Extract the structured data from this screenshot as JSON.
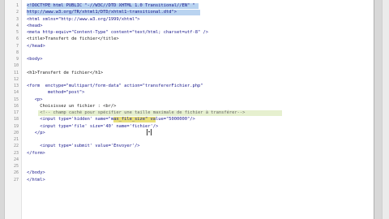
{
  "editor": {
    "line_numbers": [
      "1",
      "2",
      "3",
      "4",
      "5",
      "6",
      "7",
      "8",
      "9",
      "10",
      "11",
      "12",
      "13",
      "14",
      "15",
      "16",
      "17",
      "18",
      "19",
      "20",
      "21",
      "22",
      "23",
      "24",
      "25",
      "26",
      "27"
    ],
    "lines": [
      "<!DOCTYPE html PUBLIC \"-//W3C//DTD XHTML 1.0 Transitional//EN\" \"",
      "http://www.w3.org/TR/xhtml1/DTD/xhtml1-transitional.dtd\">",
      "<html xmlns=\"http://www.w3.org/1999/xhtml\">",
      "<head>",
      "<meta http-equiv=\"Content-Type\" content=\"text/html; charset=utf-8\" />",
      "<title>Transfert de fichier</title>",
      "</head>",
      "",
      "<body>",
      "",
      "<h1>Transfert de fichier</h1>",
      "",
      "<form  enctype=\"multipart/form-data\" action=\"transfererFichier.php\"",
      "        method=\"post\">",
      "   <p>",
      "     Choisissez un fichier : <br/>",
      "     <!-- champ caché pour spécifier une taille maximale de fichier à transférer-->",
      "     <input type='hidden' name=\"max_file_size\" value=\"5000000\"/>",
      "     <input type='file' size='40' name='fichier'/>",
      "   </p>",
      "",
      "     <input type='submit' value='Envoyer'/>",
      "</form>",
      "",
      "",
      "</body>",
      "</html>"
    ]
  }
}
